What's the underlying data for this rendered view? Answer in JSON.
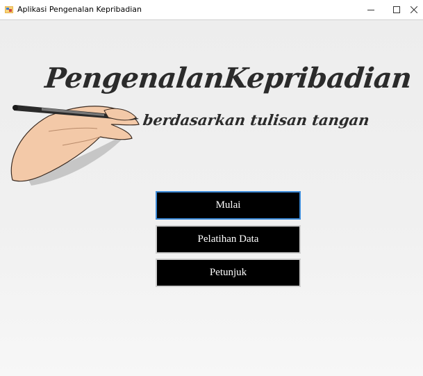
{
  "window": {
    "title": "Aplikasi Pengenalan Kepribadian"
  },
  "hero": {
    "title": "PengenalanKepribadian",
    "subtitle": "berdasarkan tulisan tangan"
  },
  "menu": {
    "buttons": [
      {
        "label": "Mulai",
        "focused": true
      },
      {
        "label": "Pelatihan Data",
        "focused": false
      },
      {
        "label": "Petunjuk",
        "focused": false
      }
    ]
  },
  "colors": {
    "button_bg": "#000000",
    "button_text": "#ffffff",
    "focus_border": "#3c8ad8",
    "title_text": "#2b2b2b"
  },
  "icons": {
    "app": "app-icon",
    "minimize": "minimize-icon",
    "maximize": "maximize-icon",
    "close": "close-icon"
  }
}
